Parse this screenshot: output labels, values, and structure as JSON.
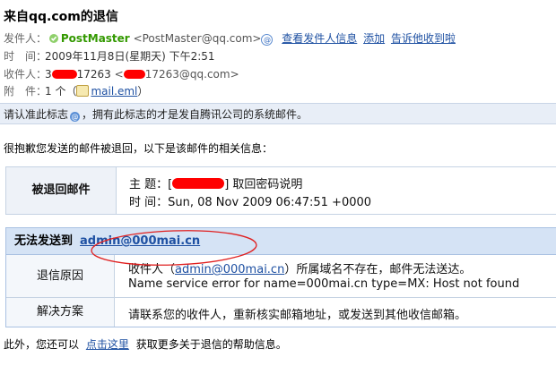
{
  "header": {
    "subject": "来自qq.com的退信",
    "sender_label": "发件人：",
    "sender_name": "PostMaster",
    "sender_address": "<PostMaster@qq.com>",
    "view_sender_link": "查看发件人信息",
    "add_link": "添加",
    "report_link": "告诉他收到啦",
    "time_label": "时　间：",
    "time_value": "2009年11月8日(星期天) 下午2:51",
    "recipient_label": "收件人：",
    "recipient_prefix": "3",
    "recipient_suffix": "17263",
    "recipient_addr_prefix": "<",
    "recipient_addr_suffix": "17263@qq.com>",
    "attach_label": "附　件：",
    "attach_count": "1 个（",
    "attach_file": "mail.eml",
    "attach_close": "）"
  },
  "notice_bar": {
    "prefix": "请认准此标志",
    "suffix": "，拥有此标志的才是发自腾讯公司的系统邮件。"
  },
  "intro_text": "很抱歉您发送的邮件被退回，以下是该邮件的相关信息：",
  "returned_mail": {
    "label": "被退回邮件",
    "subject_label": "主 题：[",
    "subject_value": "] 取回密码说明",
    "time_label": "时 间：",
    "time_value": "Sun, 08 Nov 2009 06:47:51 +0000"
  },
  "delivery_failure": {
    "label": "无法发送到",
    "address": "admin@000mai.cn",
    "reason_label": "退信原因",
    "reason_line1_pre": "收件人（",
    "reason_line1_addr": "admin@000mai.cn",
    "reason_line1_post": "）所属域名不存在，邮件无法送达。",
    "reason_line2": "Name service error for name=000mai.cn type=MX: Host not found",
    "solution_label": "解决方案",
    "solution_text": "请联系您的收件人，重新核实邮箱地址，或发送到其他收信邮箱。"
  },
  "outro": {
    "prefix": "此外，您还可以",
    "link": "点击这里",
    "suffix": "获取更多关于退信的帮助信息。"
  },
  "colors": {
    "link": "#1e50a2",
    "sender_green": "#339900",
    "redaction": "#ff0000",
    "header_blue": "#d5e3f5"
  }
}
